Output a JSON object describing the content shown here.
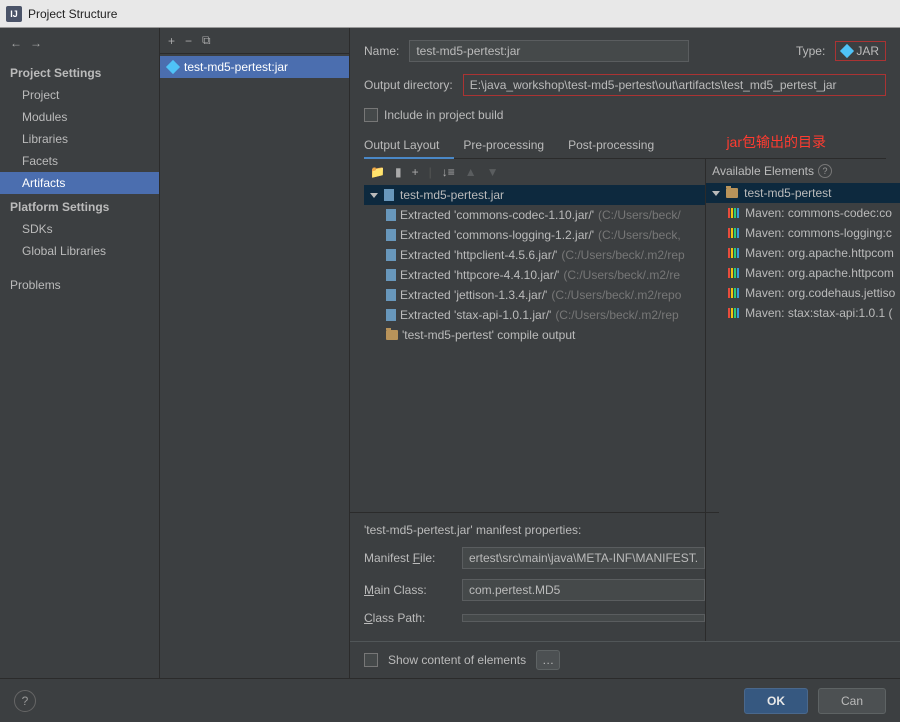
{
  "window": {
    "title": "Project Structure"
  },
  "sidebar": {
    "group1_title": "Project Settings",
    "group1_items": [
      "Project",
      "Modules",
      "Libraries",
      "Facets",
      "Artifacts"
    ],
    "group2_title": "Platform Settings",
    "group2_items": [
      "SDKs",
      "Global Libraries"
    ],
    "problems": "Problems"
  },
  "artifact_list": {
    "selected": "test-md5-pertest:jar"
  },
  "form": {
    "name_label": "Name:",
    "name_value": "test-md5-pertest:jar",
    "type_label": "Type:",
    "type_value": "JAR",
    "outdir_label": "Output directory:",
    "outdir_value": "E:\\java_workshop\\test-md5-pertest\\out\\artifacts\\test_md5_pertest_jar",
    "include_label": "Include in project build"
  },
  "annotation": "jar包输出的目录",
  "tabs": [
    "Output Layout",
    "Pre-processing",
    "Post-processing"
  ],
  "output_tree": {
    "root": "test-md5-pertest.jar",
    "items": [
      {
        "name": "Extracted 'commons-codec-1.10.jar/'",
        "path": "(C:/Users/beck/"
      },
      {
        "name": "Extracted 'commons-logging-1.2.jar/'",
        "path": "(C:/Users/beck,"
      },
      {
        "name": "Extracted 'httpclient-4.5.6.jar/'",
        "path": "(C:/Users/beck/.m2/rep"
      },
      {
        "name": "Extracted 'httpcore-4.4.10.jar/'",
        "path": "(C:/Users/beck/.m2/re"
      },
      {
        "name": "Extracted 'jettison-1.3.4.jar/'",
        "path": "(C:/Users/beck/.m2/repo"
      },
      {
        "name": "Extracted 'stax-api-1.0.1.jar/'",
        "path": "(C:/Users/beck/.m2/rep"
      },
      {
        "name": "'test-md5-pertest' compile output",
        "path": ""
      }
    ]
  },
  "available": {
    "label": "Available Elements",
    "root": "test-md5-pertest",
    "items": [
      "Maven: commons-codec:co",
      "Maven: commons-logging:c",
      "Maven: org.apache.httpcom",
      "Maven: org.apache.httpcom",
      "Maven: org.codehaus.jettiso",
      "Maven: stax:stax-api:1.0.1 ("
    ]
  },
  "manifest": {
    "heading": "'test-md5-pertest.jar' manifest properties:",
    "file_label": "Manifest File:",
    "file_value": "ertest\\src\\main\\java\\META-INF\\MANIFEST.",
    "main_label": "Main Class:",
    "main_value": "com.pertest.MD5",
    "classpath_label": "Class Path:",
    "classpath_value": ""
  },
  "show_content_label": "Show content of elements",
  "buttons": {
    "ok": "OK",
    "cancel": "Can"
  }
}
